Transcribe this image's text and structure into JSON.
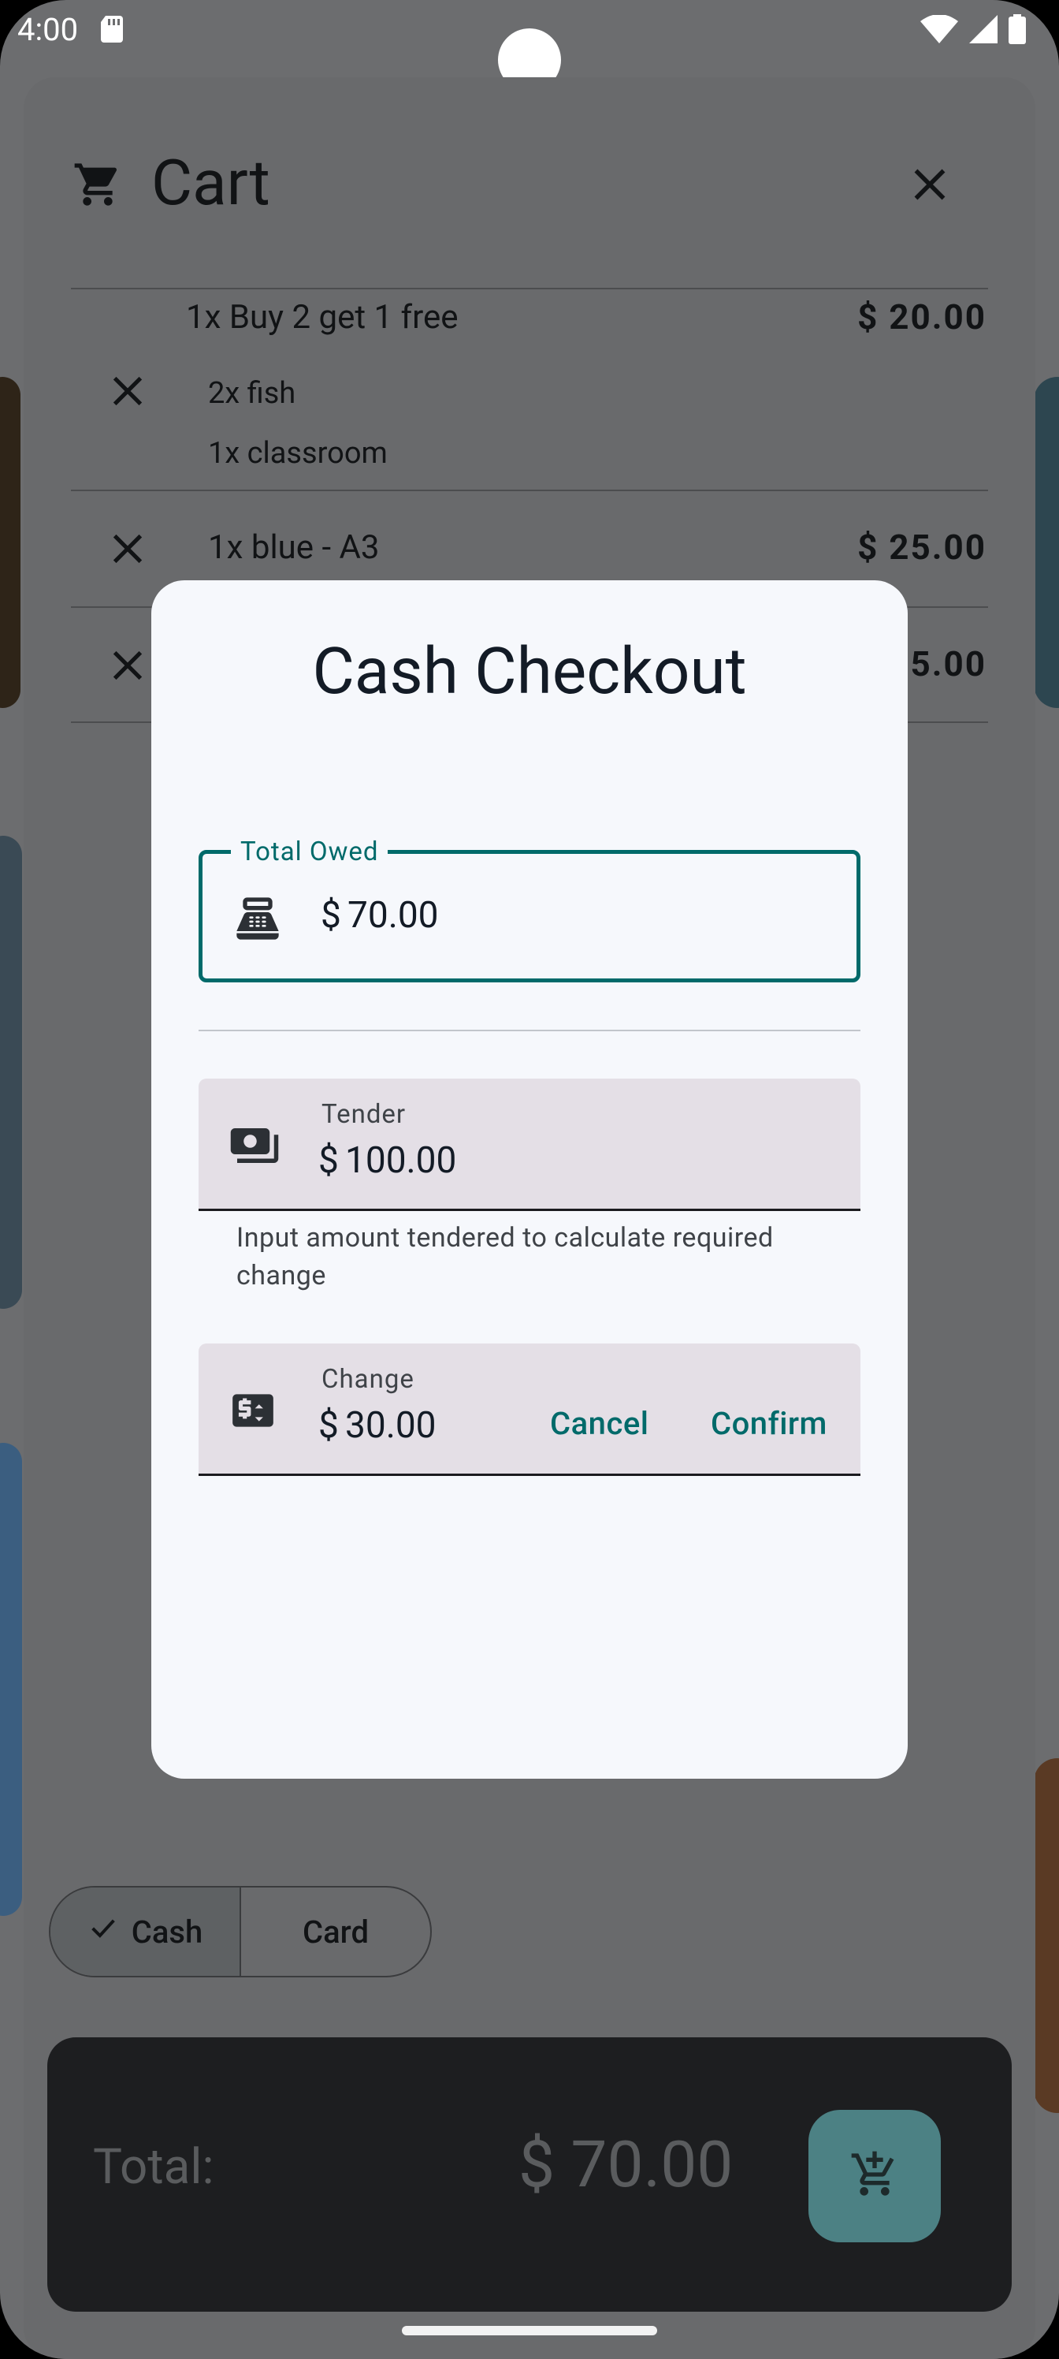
{
  "status_bar": {
    "time": "4:00"
  },
  "cart": {
    "title": "Cart",
    "items": [
      {
        "name": "1x Buy 2 get 1 free",
        "price": "$ 20.00",
        "sub": [
          "2x fish",
          "1x classroom"
        ]
      },
      {
        "name": "1x blue - A3",
        "price": "$ 25.00"
      },
      {
        "price": "5.00"
      }
    ],
    "payment_methods": [
      "Cash",
      "Card"
    ],
    "selected_payment": "Cash",
    "total_label": "Total:",
    "total_value": "$ 70.00"
  },
  "dialog": {
    "title": "Cash Checkout",
    "total_owed": {
      "label": "Total Owed",
      "prefix": "$",
      "value": "70.00"
    },
    "tender": {
      "label": "Tender",
      "prefix": "$",
      "value": "100.00",
      "helper": "Input amount tendered to calculate required change"
    },
    "change": {
      "label": "Change",
      "prefix": "$",
      "value": "30.00"
    },
    "cancel_label": "Cancel",
    "confirm_label": "Confirm"
  },
  "colors": {
    "accent": "#006a6a",
    "scrim": "#6c6d6f",
    "dialog_surface": "#f6f8fc",
    "fab": "#4c8184"
  },
  "icons": {
    "status": [
      "sd-card-icon",
      "wifi-icon",
      "signal-icon",
      "battery-icon"
    ],
    "cart": "shopping-cart-icon",
    "close": "close-icon",
    "total_owed": "point-of-sale-icon",
    "tender": "payments-icon",
    "change": "currency-exchange-icon",
    "checkout": "add-shopping-cart-icon",
    "selected": "check-icon"
  }
}
